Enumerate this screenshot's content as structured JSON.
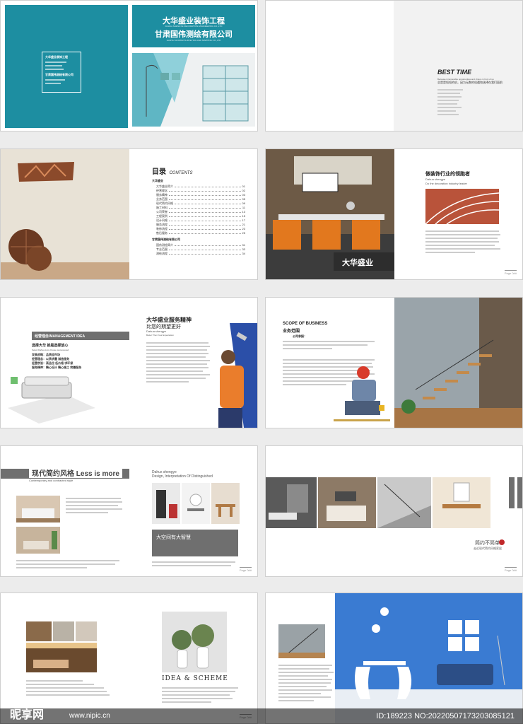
{
  "cover": {
    "company_cn": "大华盛业装饰工程",
    "company_en": "DAHUA SHENGYE DECORATION ENGINEERING CO.,LTD",
    "company2_cn": "甘肃国伟测绘有限公司",
    "company2_en": "GANSU GUOWEI SURVEYING AND MAPPING CO.,LTD",
    "box_title": "大华盛业装饰工程",
    "box_title2": "甘肃国伟测绘有限公司"
  },
  "best_time": {
    "heading": "BEST TIME",
    "en_text": "Because innumerable opportunities and choice in front of us",
    "cn_text": "总是是短短的机，因为无数的机遇和选择在我们面前"
  },
  "contents": {
    "title_cn": "目录",
    "title_en": "CONTENTS",
    "group1": "大华盛业",
    "group2": "甘肃国伟测绘有限公司",
    "items1": [
      "大华盛业简介",
      "经营理念",
      "服务精神",
      "业务范围",
      "现代简约风格",
      "施工材料",
      "公司荣誉",
      "工程案例",
      "设计风格",
      "服务流程",
      "装修流程",
      "售后服务"
    ],
    "pages1": [
      "01",
      "02",
      "03",
      "05",
      "09",
      "11",
      "13",
      "15",
      "17",
      "21",
      "23",
      "25"
    ],
    "items2": [
      "国伟测绘简介",
      "专业范围",
      "测绘流程"
    ],
    "pages2": [
      "31",
      "33",
      "34"
    ]
  },
  "leader": {
    "title": "做装饰行业的领跑者",
    "sub1": "Dahua shengye",
    "sub2": "Do the decoration industry leader",
    "banner": "大华盛业"
  },
  "management": {
    "bar": "经营理念/MANAGEMENT IDEA",
    "choose": "选择大华    就是选择放心",
    "choose_en": "Select Dahua is to choose rest assured",
    "rows": [
      "发展战略：品质迎市场",
      "经营理念：以质求量 诚信服务",
      "经营宗旨：高品位 低价格 求环保",
      "服务精神：精心设计 精心施工 完善服务"
    ]
  },
  "service": {
    "title": "大华盛业服务精神",
    "subtitle": "比您的期望更好",
    "en1": "Dahua shengye",
    "en2": "Better Than Your Expectation"
  },
  "scope": {
    "title": "SCOPE OF BUSINESS",
    "cn": "业务范围",
    "label": "公司承接："
  },
  "modern": {
    "title": "现代简约风格",
    "title_en": "Less is more",
    "sub": "Contemporary and contracted style",
    "right_en1": "Dahux shengye",
    "right_en2": "Design, Interpretation Of Distinguished",
    "banner": "大空间有大智慧"
  },
  "simple": {
    "title": "简约不简单",
    "sub": "走近现代简约风格家居"
  },
  "idea": {
    "title": "IDEA & SCHEME"
  },
  "footer": {
    "page_label": "Page 0##"
  },
  "watermark": {
    "logo": "昵享网",
    "url": "www.nipic.cn",
    "id": "ID:189223 NO:20220507173203085121"
  },
  "colors": {
    "teal": "#1d8ea1",
    "gray": "#6f6f6f",
    "orange": "#e6862e",
    "blue": "#2e6fc7"
  }
}
